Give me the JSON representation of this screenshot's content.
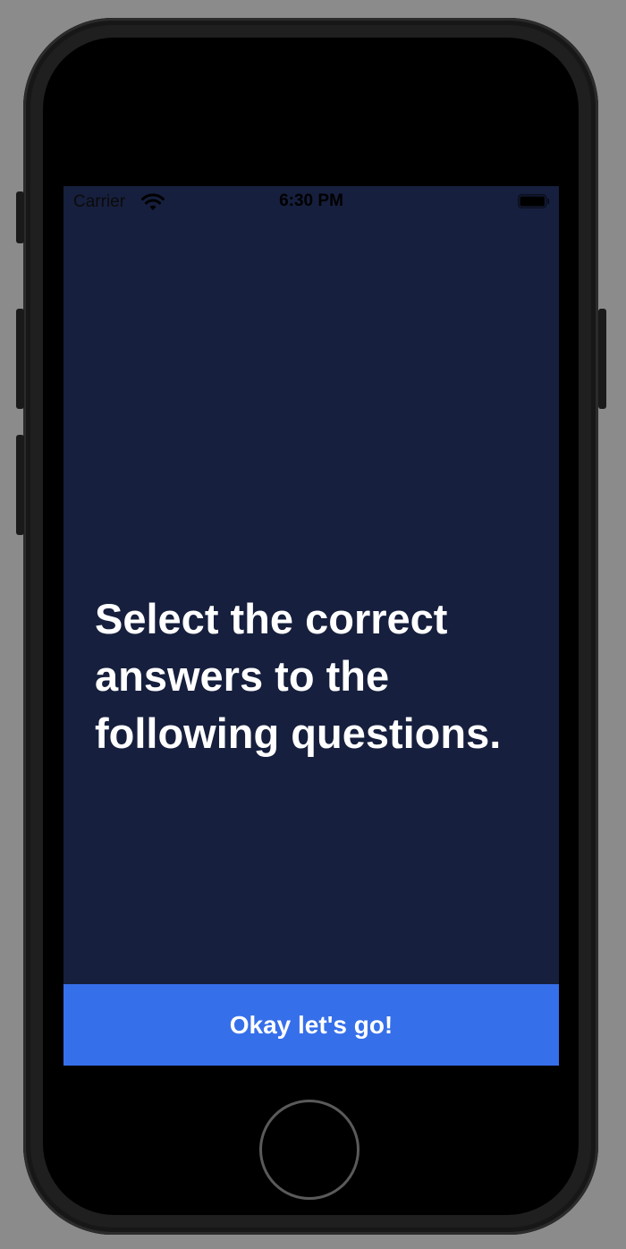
{
  "status_bar": {
    "carrier": "Carrier",
    "time": "6:30 PM",
    "wifi_icon": "wifi-icon",
    "battery_icon": "battery-icon"
  },
  "intro": {
    "headline": "Select the correct answers to the following questions."
  },
  "cta": {
    "label": "Okay let's go!"
  },
  "colors": {
    "screen_background": "#161f3d",
    "button_background": "#366fea",
    "text": "#ffffff"
  }
}
